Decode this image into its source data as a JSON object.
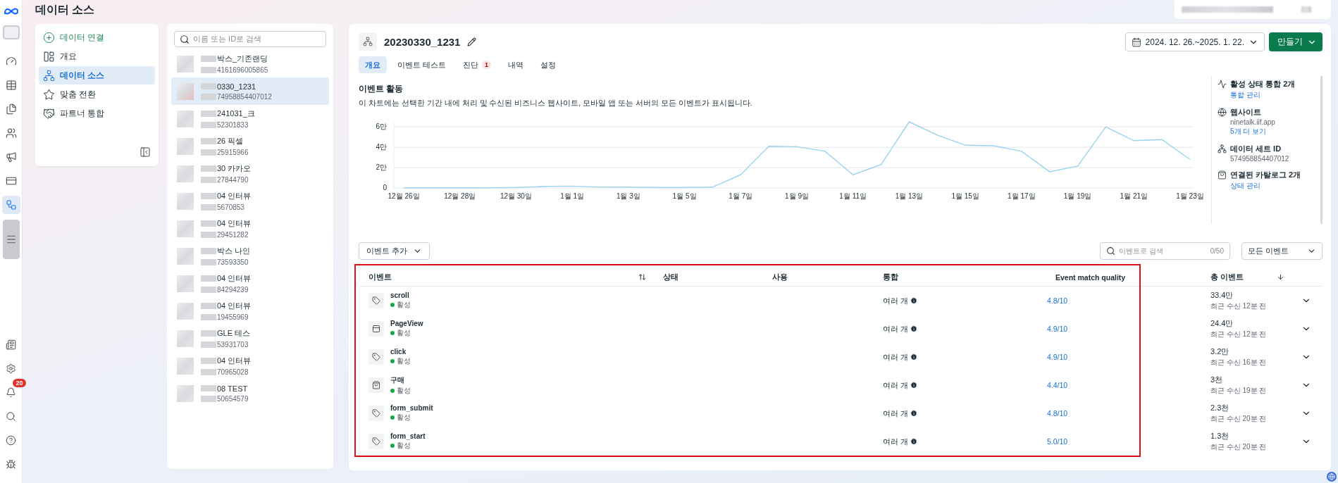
{
  "page_title": "데이터 소스",
  "nav_rail": {
    "items": [
      {
        "kind": "dashboard",
        "selected": false
      },
      {
        "kind": "table",
        "selected": false
      },
      {
        "kind": "pages",
        "selected": false
      },
      {
        "kind": "audience",
        "selected": false
      },
      {
        "kind": "ads",
        "selected": false
      },
      {
        "kind": "billing",
        "selected": false
      },
      {
        "kind": "data",
        "selected": true
      }
    ],
    "bottom": [
      {
        "kind": "news"
      },
      {
        "kind": "settings"
      },
      {
        "kind": "alerts",
        "badge": "20"
      },
      {
        "kind": "search"
      },
      {
        "kind": "help"
      },
      {
        "kind": "debug"
      }
    ]
  },
  "nav_menu": [
    {
      "kind": "action",
      "label": "데이터 연결",
      "selected": false
    },
    {
      "kind": "overview",
      "label": "개요",
      "selected": false
    },
    {
      "kind": "sources",
      "label": "데이터 소스",
      "selected": true
    },
    {
      "kind": "conversions",
      "label": "맞춤 전환",
      "selected": false
    },
    {
      "kind": "partners",
      "label": "파트너 통합",
      "selected": false
    }
  ],
  "source_list": {
    "search_placeholder": "이름 또는 ID로 검색",
    "items": [
      {
        "name": "박스_기존랜딩",
        "id": "4161696005865",
        "selected": false
      },
      {
        "name": "0330_1231",
        "id": "74958854407012",
        "selected": true
      },
      {
        "name": "241031_크",
        "id": "52301833",
        "selected": false
      },
      {
        "name": "26 픽셀",
        "id": "25915966",
        "selected": false
      },
      {
        "name": "30 카카오",
        "id": "27844790",
        "selected": false
      },
      {
        "name": "04 인터뷰",
        "id": "5670853",
        "selected": false
      },
      {
        "name": "04 인터뷰",
        "id": "29451282",
        "selected": false
      },
      {
        "name": "박스 나인",
        "id": "73593350",
        "selected": false
      },
      {
        "name": "04 인터뷰",
        "id": "84294239",
        "selected": false
      },
      {
        "name": "04 인터뷰",
        "id": "19455969",
        "selected": false
      },
      {
        "name": "GLE 테스",
        "id": "53931703",
        "selected": false
      },
      {
        "name": "04 인터뷰",
        "id": "70965028",
        "selected": false
      },
      {
        "name": "08 TEST",
        "id": "50654579",
        "selected": false
      }
    ]
  },
  "detail": {
    "title": "20230330_1231",
    "tabs": [
      {
        "label": "개요",
        "selected": true
      },
      {
        "label": "이벤트 테스트",
        "selected": false
      },
      {
        "label": "진단",
        "selected": false,
        "badge": "1"
      },
      {
        "label": "내역",
        "selected": false
      },
      {
        "label": "설정",
        "selected": false
      }
    ],
    "date_range": "2024. 12. 26.~2025. 1. 22.",
    "create_button": "만들기",
    "activity": {
      "title": "이벤트 활동",
      "description": "이 차트에는 선택한 기간 내에 처리 및 수신된 비즈니스 웹사이트, 모바일 앱 또는 서버의 모든 이벤트가 표시됩니다.",
      "chart_data": {
        "type": "line",
        "categories": [
          "12월 26일",
          null,
          "12월 28일",
          null,
          "12월 30일",
          null,
          "1월 1일",
          null,
          "1월 3일",
          null,
          "1월 5일",
          null,
          "1월 7일",
          null,
          "1월 9일",
          null,
          "1월 11일",
          null,
          "1월 13일",
          null,
          "1월 15일",
          null,
          "1월 17일",
          null,
          "1월 19일",
          null,
          "1월 21일",
          null,
          "1월 23일"
        ],
        "series": [
          {
            "color": "#9ad3ec",
            "values": [
              0.02,
              0.02,
              0.02,
              0.03,
              0.05,
              0.15,
              0.18,
              0.1,
              0.08,
              0.05,
              0.05,
              0.08,
              1.3,
              4.1,
              4.05,
              3.6,
              1.3,
              2.3,
              6.5,
              5.2,
              4.2,
              4.15,
              3.6,
              1.6,
              2.15,
              6.0,
              4.65,
              4.75,
              2.8
            ]
          }
        ],
        "grid": true,
        "ylim": [
          0,
          6.5
        ],
        "yticks": [
          {
            "value": 0,
            "label": "0"
          },
          {
            "value": 2,
            "label": "2만"
          },
          {
            "value": 4,
            "label": "4만"
          },
          {
            "value": 6,
            "label": "6만"
          }
        ]
      }
    },
    "info": [
      {
        "kind": "integrations",
        "title": "활성 상태 통합 2개",
        "lines": [
          {
            "kind": "link",
            "text": "통합 관리"
          }
        ]
      },
      {
        "kind": "website",
        "title": "웹사이트",
        "lines": [
          {
            "kind": "text",
            "text": "ninetalk.iif.app"
          },
          {
            "kind": "link",
            "text": "5개 더 보기"
          }
        ]
      },
      {
        "kind": "dataset",
        "title": "데이터 세트 ID",
        "lines": [
          {
            "kind": "text",
            "text": "574958854407012"
          }
        ]
      },
      {
        "kind": "catalog",
        "title": "연결된 카탈로그 2개",
        "lines": [
          {
            "kind": "link",
            "text": "상태 관리"
          }
        ]
      }
    ],
    "toolbar": {
      "add_event": "이벤트 추가",
      "search_placeholder": "이벤트로 검색",
      "count": "0/50",
      "filter": "모든 이벤트"
    },
    "table": {
      "columns": [
        {
          "kind": "sortable",
          "label": "이벤트"
        },
        {
          "kind": "plain",
          "label": "상태"
        },
        {
          "kind": "plain",
          "label": "사용"
        },
        {
          "kind": "plain",
          "label": "통합"
        },
        {
          "kind": "plain",
          "label": "Event match quality"
        },
        {
          "kind": "sorted",
          "label": "총 이벤트"
        }
      ],
      "rows": [
        {
          "kind": "tag",
          "name": "scroll",
          "status": "활성",
          "active": true,
          "integration": "여러 개",
          "quality": "4.8/10",
          "total": "33.4만",
          "received": "최근 수신 12분 전"
        },
        {
          "kind": "page",
          "name": "PageView",
          "status": "활성",
          "active": true,
          "integration": "여러 개",
          "quality": "4.9/10",
          "total": "24.4만",
          "received": "최근 수신 12분 전"
        },
        {
          "kind": "tag",
          "name": "click",
          "status": "활성",
          "active": true,
          "integration": "여러 개",
          "quality": "4.9/10",
          "total": "3.2만",
          "received": "최근 수신 16분 전"
        },
        {
          "kind": "purchase",
          "name": "구매",
          "status": "활성",
          "active": true,
          "integration": "여러 개",
          "quality": "4.4/10",
          "total": "3천",
          "received": "최근 수신 19분 전"
        },
        {
          "kind": "tag",
          "name": "form_submit",
          "status": "활성",
          "active": true,
          "integration": "여러 개",
          "quality": "4.8/10",
          "total": "2.3천",
          "received": "최근 수신 20분 전"
        },
        {
          "kind": "tag",
          "name": "form_start",
          "status": "활성",
          "active": true,
          "integration": "여러 개",
          "quality": "5.0/10",
          "total": "1.3천",
          "received": "최근 수신 20분 전"
        }
      ]
    }
  }
}
